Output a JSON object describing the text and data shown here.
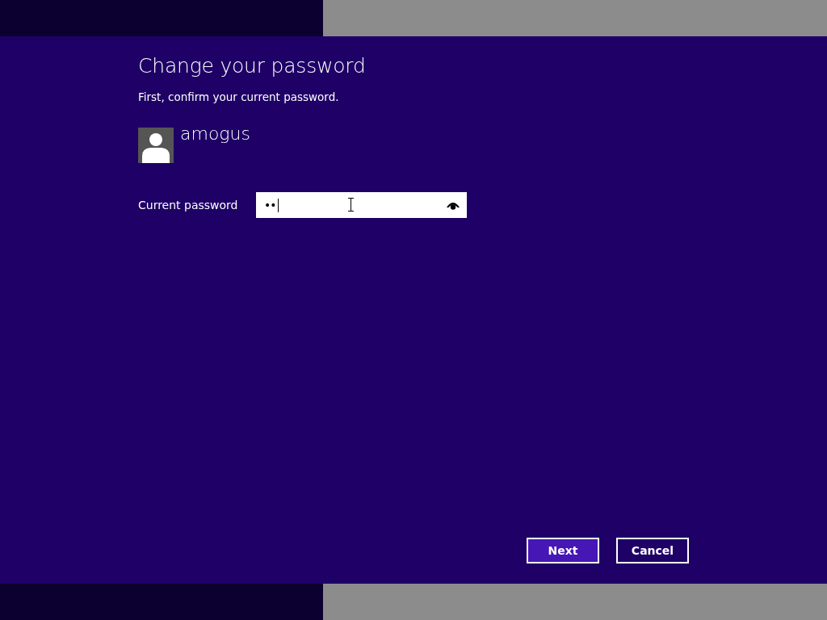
{
  "title": "Change your password",
  "instruction": "First, confirm your current password.",
  "user": {
    "name": "amogus"
  },
  "fields": [
    {
      "label": "Current password",
      "value": "••",
      "focused": true
    }
  ],
  "buttons": [
    {
      "label": "Next",
      "default": true
    },
    {
      "label": "Cancel",
      "default": false
    }
  ]
}
